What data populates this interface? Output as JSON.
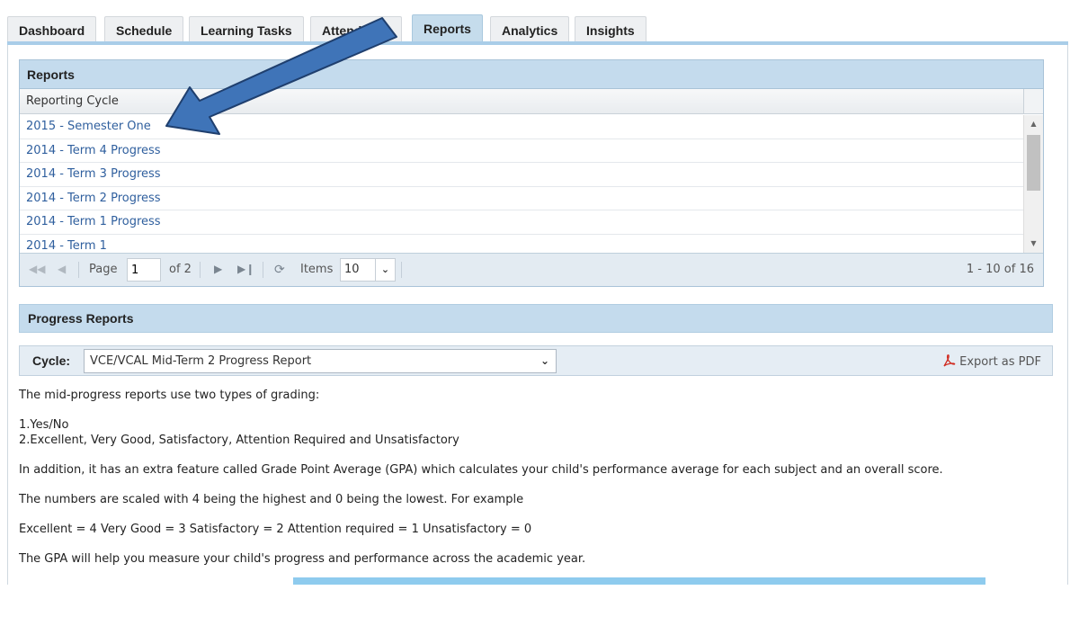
{
  "tabs": [
    {
      "label": "Dashboard",
      "active": false
    },
    {
      "label": "Schedule",
      "active": false
    },
    {
      "label": "Learning Tasks",
      "active": false
    },
    {
      "label": "Attendance",
      "active": false
    },
    {
      "label": "Reports",
      "active": true
    },
    {
      "label": "Analytics",
      "active": false
    },
    {
      "label": "Insights",
      "active": false
    }
  ],
  "reports": {
    "title": "Reports",
    "column_header": "Reporting Cycle",
    "rows": [
      "2015 - Semester One",
      "2014 - Term 4 Progress",
      "2014 - Term 3 Progress",
      "2014 - Term 2 Progress",
      "2014 - Term 1 Progress",
      "2014 - Term 1"
    ],
    "pager": {
      "page_label": "Page",
      "page_value": "1",
      "of_label": "of 2",
      "items_label": "Items",
      "items_value": "10",
      "range": "1 - 10 of 16"
    }
  },
  "progress": {
    "title": "Progress Reports",
    "cycle_label": "Cycle:",
    "cycle_value": "VCE/VCAL Mid-Term 2 Progress Report",
    "export_label": "Export as PDF",
    "lines": [
      "The mid-progress reports use two types of grading:",
      "1.Yes/No",
      "2.Excellent, Very Good, Satisfactory, Attention Required and Unsatisfactory",
      "In addition, it has an extra feature called Grade Point Average (GPA) which calculates your child's performance average for each subject and an overall score.",
      "The numbers are scaled with 4 being the highest and 0 being the lowest. For example",
      "Excellent = 4 Very Good = 3 Satisfactory = 2 Attention required = 1 Unsatisfactory = 0",
      "The GPA will help you measure your child's progress and performance across the academic year."
    ]
  },
  "colors": {
    "accent": "#c4dbed",
    "link": "#2f5f9e",
    "arrow": "#3f74b8"
  }
}
